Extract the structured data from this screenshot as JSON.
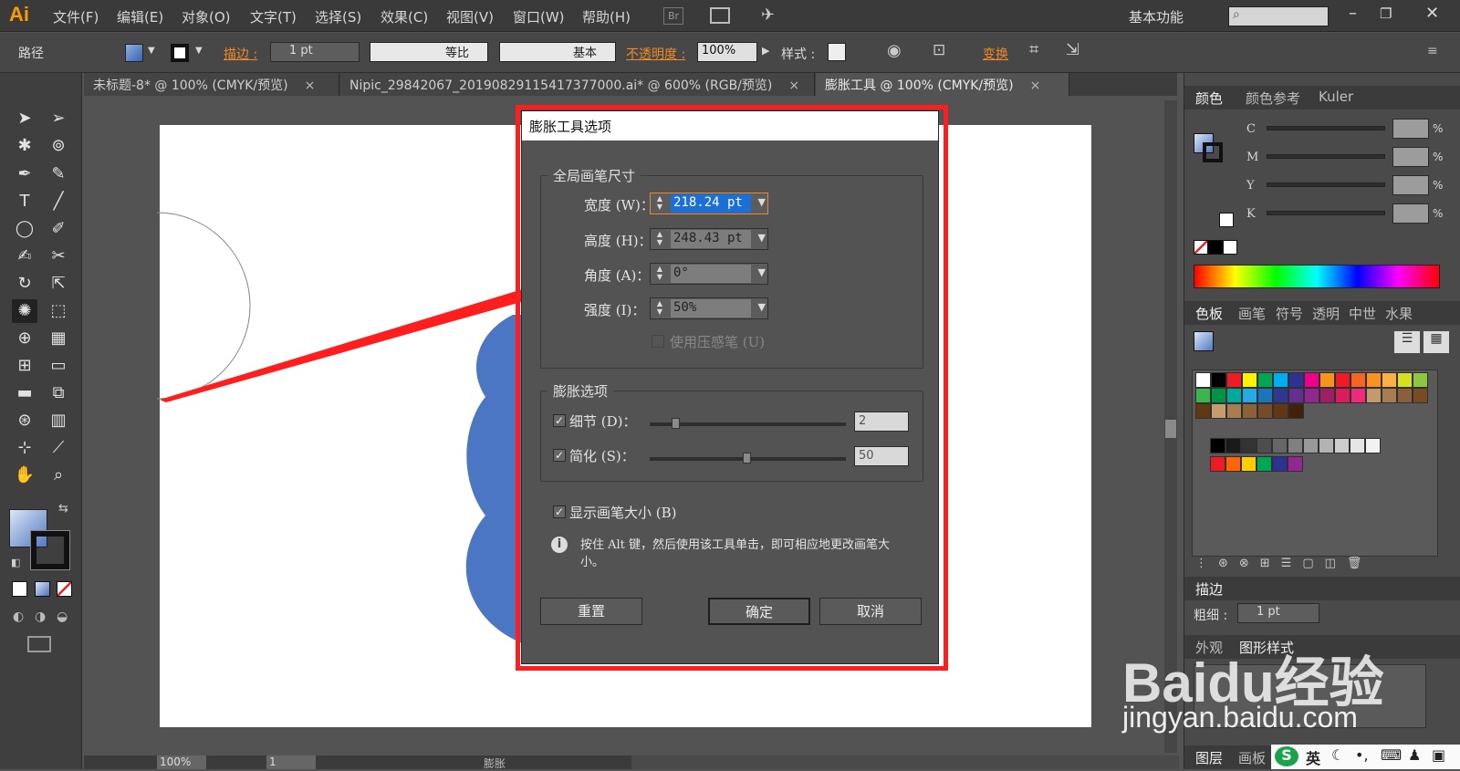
{
  "app": {
    "logo": "Ai",
    "workspace": "基本功能"
  },
  "menubar": {
    "items": [
      "文件(F)",
      "编辑(E)",
      "对象(O)",
      "文字(T)",
      "选择(S)",
      "效果(C)",
      "视图(V)",
      "窗口(W)",
      "帮助(H)"
    ],
    "br": "Br"
  },
  "control_bar": {
    "object_type": "路径",
    "stroke_label": "描边 :",
    "stroke_value": "1 pt",
    "profile_label": "等比",
    "brush_label": "基本",
    "opacity_label": "不透明度 :",
    "opacity_value": "100%",
    "style_label": "样式 :",
    "transform_label": "变换"
  },
  "tabs": [
    {
      "label": "未标题-8* @ 100% (CMYK/预览)",
      "close": "×"
    },
    {
      "label": "Nipic_29842067_20190829115417377000.ai* @ 600% (RGB/预览)",
      "close": "×"
    },
    {
      "label": "膨胀工具 @ 100% (CMYK/预览)",
      "close": "×"
    }
  ],
  "color_panel": {
    "tabs": [
      "颜色",
      "颜色参考",
      "Kuler"
    ],
    "channels": [
      {
        "name": "C",
        "unit": "%"
      },
      {
        "name": "M",
        "unit": "%"
      },
      {
        "name": "Y",
        "unit": "%"
      },
      {
        "name": "K",
        "unit": "%"
      }
    ]
  },
  "swatch_panel": {
    "tabs": [
      "色板",
      "画笔",
      "符号",
      "透明",
      "中世",
      "水果"
    ],
    "swatch_colors": [
      "#ffffff",
      "#000000",
      "#ee1c24",
      "#fff200",
      "#00a651",
      "#00aeef",
      "#2e3192",
      "#ec008c",
      "#f7941d",
      "#ed1c24",
      "#f26522",
      "#f7931e",
      "#fbb040",
      "#d7df23",
      "#8dc63f",
      "#39b54a",
      "#009444",
      "#00a99d",
      "#27aae1",
      "#1c75bc",
      "#2b3990",
      "#662d91",
      "#92278f",
      "#9e1f63",
      "#da1c5c",
      "#ee2a7b",
      "#c49a6c",
      "#a67c52",
      "#8b5e3c",
      "#754c24",
      "#603913",
      "#c69c6d",
      "#a97c50",
      "#8c6239",
      "#754c29",
      "#603813",
      "#42210b"
    ],
    "gray_swatches": [
      "#000000",
      "#1a1a1a",
      "#333333",
      "#4d4d4d",
      "#666666",
      "#808080",
      "#999999",
      "#b3b3b3",
      "#cccccc",
      "#e6e6e6",
      "#f2f2f2"
    ],
    "bright_swatches": [
      "#ed1c24",
      "#ff6600",
      "#ffcc00",
      "#00a651",
      "#2e3192",
      "#92278f"
    ]
  },
  "stroke_panel": {
    "title": "描边",
    "weight_label": "粗细 :",
    "weight_value": "1 pt"
  },
  "appearance_panel": {
    "tabs": [
      "外观",
      "图形样式"
    ]
  },
  "layers_panel": {
    "tabs": [
      "图层",
      "画板"
    ]
  },
  "dialog": {
    "title": "膨胀工具选项",
    "global_brush": {
      "group_title": "全局画笔尺寸",
      "width_label": "宽度 (W)：",
      "width_value": "218.24 pt",
      "height_label": "高度 (H)：",
      "height_value": "248.43 pt",
      "angle_label": "角度 (A)：",
      "angle_value": "0°",
      "intensity_label": "强度 (I)：",
      "intensity_value": "50%",
      "pressure_label": "使用压感笔 (U)"
    },
    "bloat_options": {
      "group_title": "膨胀选项",
      "detail_label": "细节 (D)：",
      "detail_value": "2",
      "simplify_label": "简化 (S)：",
      "simplify_value": "50"
    },
    "show_brush_size_label": "显示画笔大小 (B)",
    "info_text": "按住 Alt 键，然后使用该工具单击，即可相应地更改画笔大小。",
    "reset_button": "重置",
    "ok_button": "确定",
    "cancel_button": "取消"
  },
  "status_bar": {
    "zoom": "100%",
    "page": "1",
    "tool_name": "膨胀"
  },
  "watermark": {
    "line1": "Baidu经验",
    "line2": "jingyan.baidu.com"
  },
  "ime": {
    "lang": "英"
  },
  "colors": {
    "red_annotation": "#ff1e1e",
    "shape_blue": "#4a76c4"
  }
}
